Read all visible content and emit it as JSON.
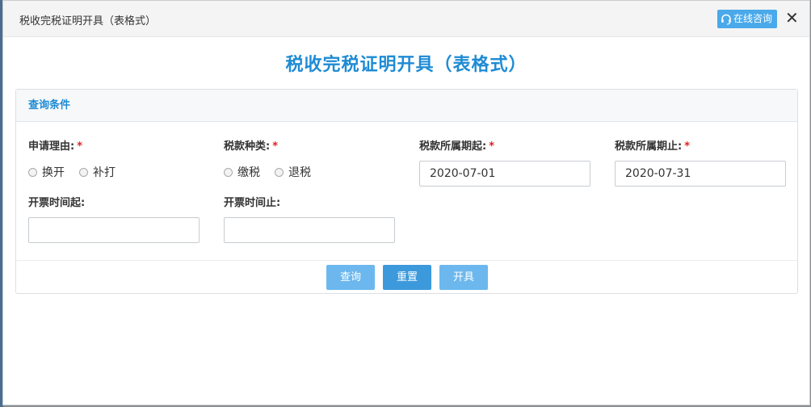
{
  "window": {
    "title": "税收完税证明开具（表格式）",
    "consult_label": "在线咨询",
    "close_label": "✕"
  },
  "page": {
    "heading": "税收完税证明开具（表格式）"
  },
  "panel": {
    "header": "查询条件",
    "fields": {
      "reason": {
        "label": "申请理由:",
        "required": "*",
        "options": [
          "换开",
          "补打"
        ]
      },
      "tax_type": {
        "label": "税款种类:",
        "required": "*",
        "options": [
          "缴税",
          "退税"
        ]
      },
      "period_start": {
        "label": "税款所属期起:",
        "required": "*",
        "value": "2020-07-01"
      },
      "period_end": {
        "label": "税款所属期止:",
        "required": "*",
        "value": "2020-07-31"
      },
      "issue_start": {
        "label": "开票时间起:",
        "value": ""
      },
      "issue_end": {
        "label": "开票时间止:",
        "value": ""
      }
    }
  },
  "buttons": {
    "query": "查询",
    "reset": "重置",
    "issue": "开具"
  },
  "colors": {
    "accent": "#1e8bd4",
    "button_light": "#6cb8ee",
    "button_primary": "#3c99dc",
    "required": "#e02020"
  }
}
